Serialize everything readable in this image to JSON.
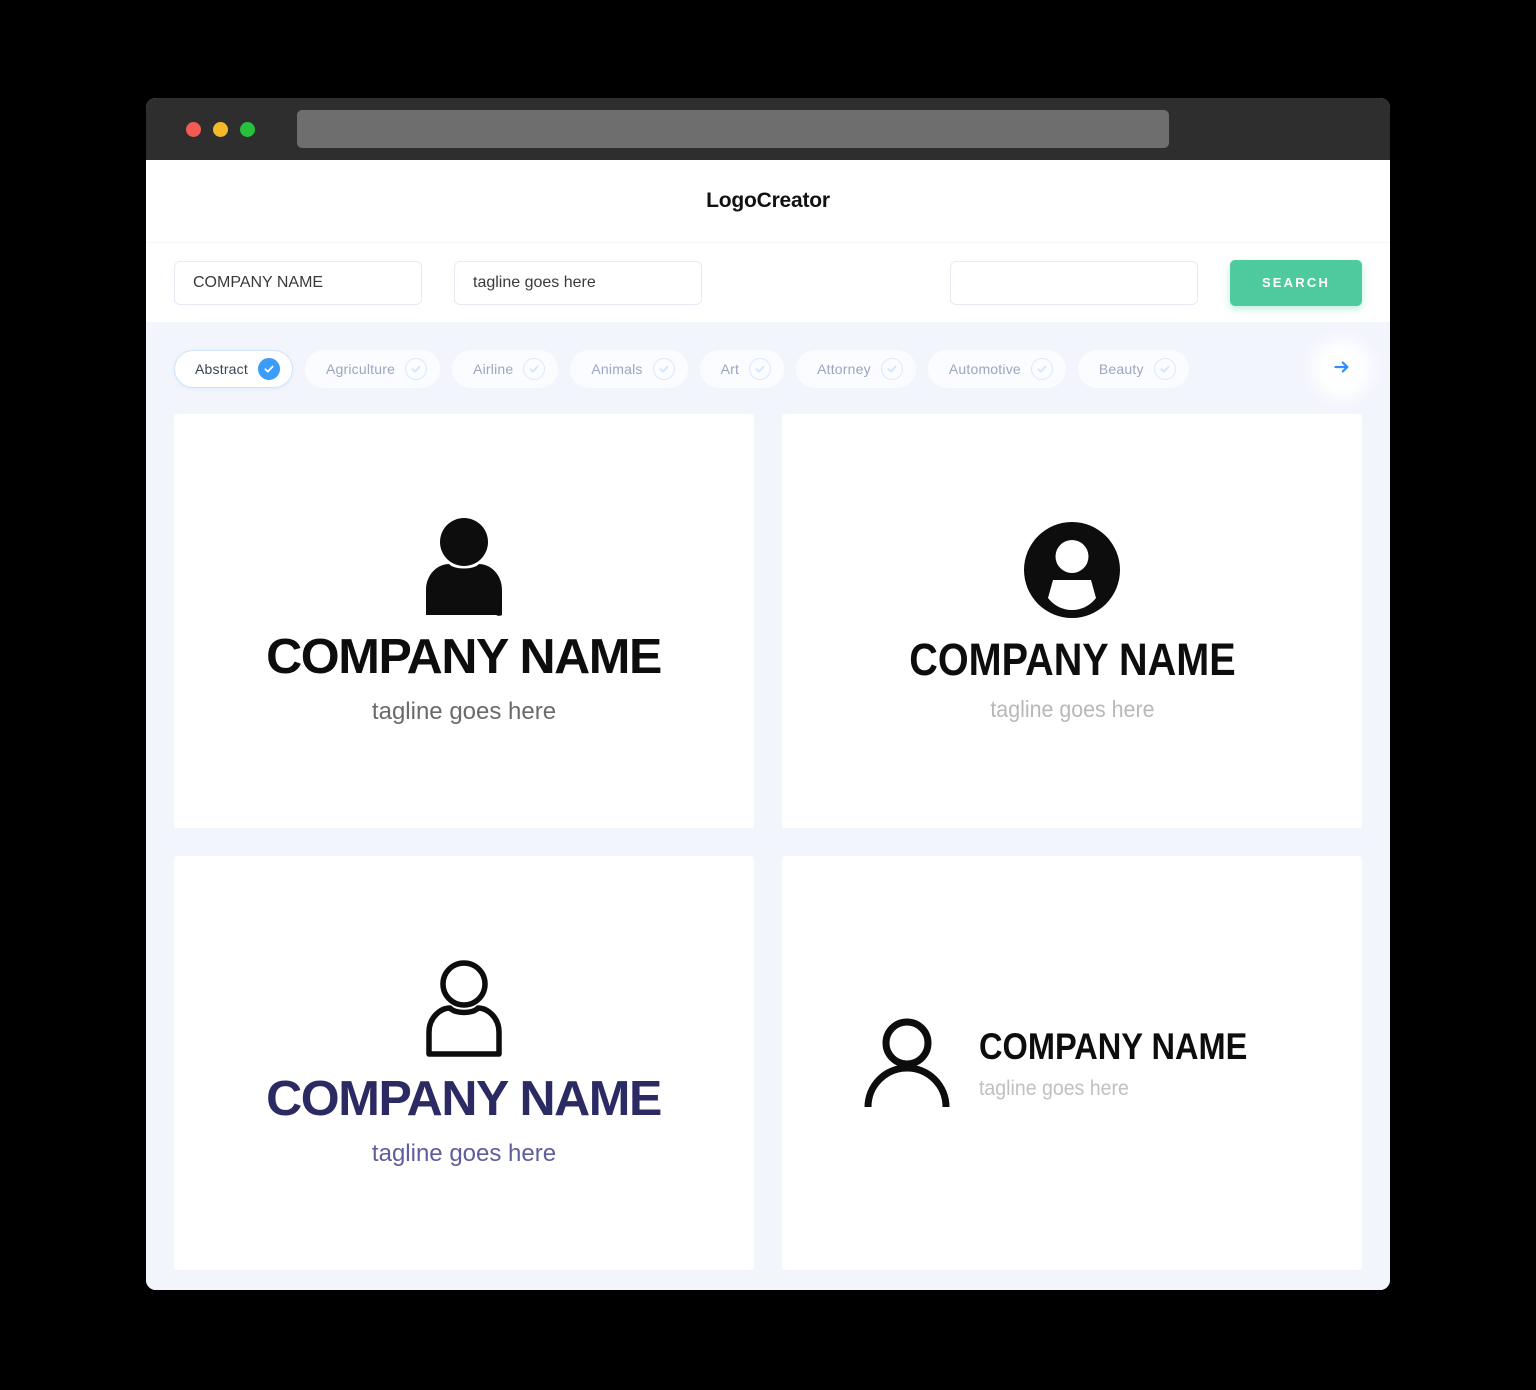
{
  "window": {
    "traffic_lights": [
      {
        "name": "close",
        "color": "#f45b52"
      },
      {
        "name": "minimize",
        "color": "#f5b829"
      },
      {
        "name": "maximize",
        "color": "#28c13e"
      }
    ],
    "address_bar_value": ""
  },
  "header": {
    "title": "LogoCreator"
  },
  "search": {
    "company_name_value": "COMPANY NAME",
    "company_name_placeholder": "COMPANY NAME",
    "tagline_value": "tagline goes here",
    "tagline_placeholder": "tagline goes here",
    "keyword_value": "",
    "keyword_placeholder": "",
    "search_label": "SEARCH",
    "search_button_color": "#4ecb9e"
  },
  "categories": {
    "next_icon": "arrow-right-icon",
    "accent_color": "#3b9cfa",
    "items": [
      {
        "label": "Abstract",
        "selected": true
      },
      {
        "label": "Agriculture",
        "selected": false
      },
      {
        "label": "Airline",
        "selected": false
      },
      {
        "label": "Animals",
        "selected": false
      },
      {
        "label": "Art",
        "selected": false
      },
      {
        "label": "Attorney",
        "selected": false
      },
      {
        "label": "Automotive",
        "selected": false
      },
      {
        "label": "Beauty",
        "selected": false
      }
    ]
  },
  "logos": [
    {
      "icon": "person-solid-icon",
      "name": "COMPANY NAME",
      "tagline": "tagline goes here",
      "name_color": "#0d0d0d",
      "tagline_color": "#6a6a6a",
      "layout": "stacked"
    },
    {
      "icon": "person-circle-badge-icon",
      "name": "COMPANY NAME",
      "tagline": "tagline goes here",
      "name_color": "#0d0d0d",
      "tagline_color": "#b8b8b8",
      "layout": "stacked"
    },
    {
      "icon": "person-outline-icon",
      "name": "COMPANY NAME",
      "tagline": "tagline goes here",
      "name_color": "#2b2a63",
      "tagline_color": "#5f5d9c",
      "layout": "stacked"
    },
    {
      "icon": "person-outline-arc-icon",
      "name": "COMPANY NAME",
      "tagline": "tagline goes here",
      "name_color": "#0d0d0d",
      "tagline_color": "#c0c0c0",
      "layout": "horizontal"
    }
  ]
}
